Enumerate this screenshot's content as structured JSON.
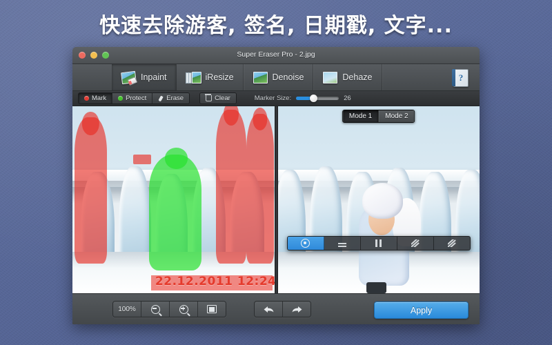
{
  "headline": "快速去除游客, 签名, 日期戳, 文字...",
  "window": {
    "title": "Super Eraser Pro - 2.jpg",
    "lights": {
      "close": "close-button",
      "minimize": "minimize-button",
      "zoom": "zoom-button"
    }
  },
  "toolbar": {
    "tabs": [
      {
        "label": "Inpaint",
        "icon": "photo-eraser-icon",
        "active": true
      },
      {
        "label": "iResize",
        "icon": "photo-stack-icon",
        "active": false
      },
      {
        "label": "Denoise",
        "icon": "photo-icon",
        "active": false
      },
      {
        "label": "Dehaze",
        "icon": "photo-icon",
        "active": false
      }
    ],
    "help": {
      "label": "?",
      "icon": "help-book-icon"
    }
  },
  "options": {
    "mark_label": "Mark",
    "protect_label": "Protect",
    "erase_label": "Erase",
    "clear_label": "Clear",
    "marker_size_label": "Marker Size:",
    "marker_size_value": "26",
    "active_tool": "Mark"
  },
  "modes": {
    "mode1_label": "Mode 1",
    "mode2_label": "Mode 2",
    "selected": "Mode 1"
  },
  "palette": {
    "buttons": [
      {
        "icon": "target-icon",
        "active": true
      },
      {
        "icon": "dash-lines-icon",
        "active": false
      },
      {
        "icon": "pause-bars-icon",
        "active": false
      },
      {
        "icon": "slash-lines-icon",
        "active": false
      },
      {
        "icon": "slash-lines-icon",
        "active": false
      }
    ]
  },
  "image": {
    "date_stamp": "22.12.2011  12:24"
  },
  "bottom": {
    "zoom_level": "100%",
    "zoom_out": "zoom-out-icon",
    "zoom_in": "zoom-in-icon",
    "fit": "fit-to-screen-icon",
    "undo": "undo-icon",
    "redo": "redo-icon",
    "apply_label": "Apply"
  },
  "colors": {
    "backdrop": "#5a6a99",
    "accent_blue": "#2a8ada",
    "mark_red": "#e8281e",
    "protect_green": "#28e12d"
  }
}
